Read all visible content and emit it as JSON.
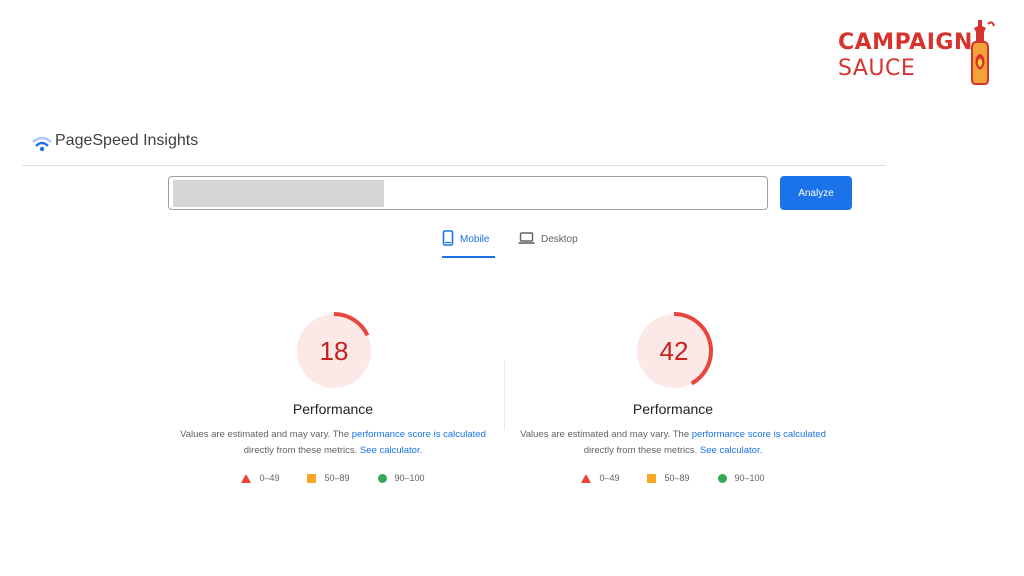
{
  "brand": {
    "line1": "CAMPAIGN",
    "line2": "SAUCE",
    "accent_color": "#d6332c"
  },
  "header": {
    "title": "PageSpeed Insights",
    "logo_icon": "pagespeed-logo-icon"
  },
  "search": {
    "value": "",
    "button_label": "Analyze"
  },
  "tabs": [
    {
      "label": "Mobile",
      "icon": "mobile-phone-icon",
      "active": true
    },
    {
      "label": "Desktop",
      "icon": "laptop-icon",
      "active": false
    }
  ],
  "panels": [
    {
      "score": "18",
      "score_fraction": 0.18,
      "label": "Performance",
      "desc_prefix": "Values are estimated and may vary. The ",
      "desc_link1": "performance score is calculated",
      "desc_mid": "directly from these metrics. ",
      "desc_link2": "See calculator."
    },
    {
      "score": "42",
      "score_fraction": 0.42,
      "label": "Performance",
      "desc_prefix": "Values are estimated and may vary. The ",
      "desc_link1": "performance score is calculated",
      "desc_mid": "directly from these metrics. ",
      "desc_link2": "See calculator."
    }
  ],
  "legend": [
    {
      "range": "0–49",
      "symbol": "triangle",
      "color": "#e8453c"
    },
    {
      "range": "50–89",
      "symbol": "square",
      "color": "#f9a825"
    },
    {
      "range": "90–100",
      "symbol": "circle",
      "color": "#34a853"
    }
  ],
  "colors": {
    "poor": "#c5221f",
    "gauge_bg": "#fce8e6",
    "arc": "#e8453c",
    "link": "#1a73e8"
  }
}
